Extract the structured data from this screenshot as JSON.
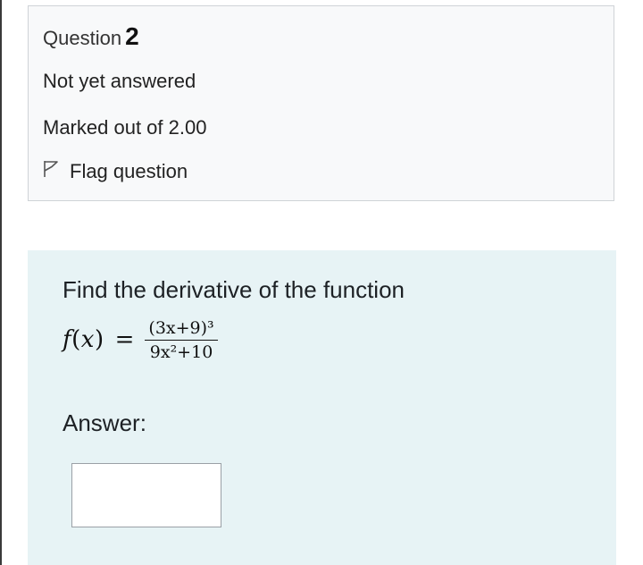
{
  "question_info": {
    "question_label": "Question",
    "question_number": "2",
    "state": "Not yet answered",
    "grade": "Marked out of 2.00",
    "flag_label": "Flag question",
    "flag_icon": "flag-outline-icon"
  },
  "formulation": {
    "prompt": "Find the derivative of the function",
    "function": {
      "lhs_name": "f",
      "lhs_open": "(",
      "lhs_var": "x",
      "lhs_close": ")",
      "equals": "=",
      "numerator": "(3x+9)³",
      "denominator": "9x²+10"
    },
    "answer_label": "Answer:",
    "answer_value": ""
  },
  "colors": {
    "info_background": "#f8f9fa",
    "info_border": "#cfd3d7",
    "formulation_background": "#e7f3f5",
    "text": "#1d2125"
  }
}
